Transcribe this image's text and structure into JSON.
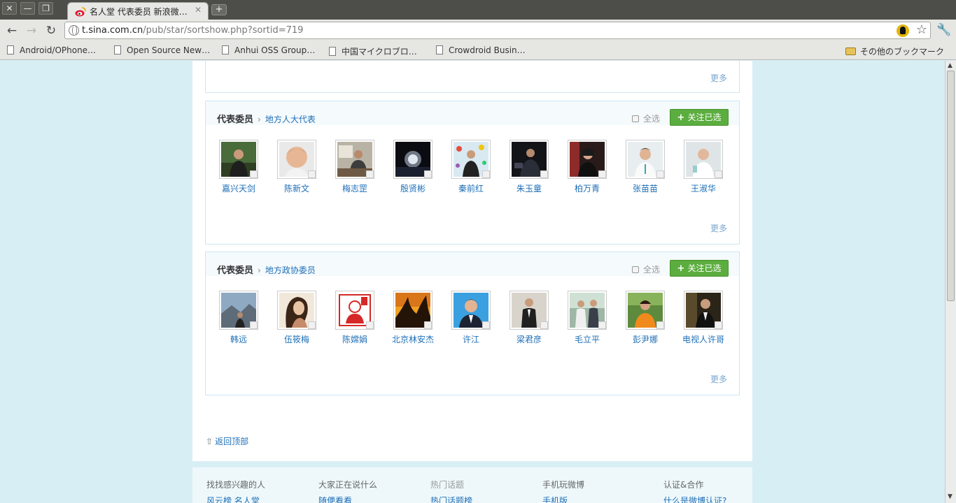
{
  "browser": {
    "tab_title": "名人堂 代表委员 新浪微…",
    "url_host": "t.sina.com.cn",
    "url_path": "/pub/star/sortshow.php?sortid=719",
    "bookmarks": [
      "Android/OPhone…",
      "Open Source New…",
      "Anhui OSS Group…",
      "中国マイクロブロ…",
      "Crowdroid Busin…"
    ],
    "other_bookmarks": "その他のブックマーク"
  },
  "top_panel": {
    "more": "更多"
  },
  "panels": [
    {
      "category": "代表委员",
      "subcategory": "地方人大代表",
      "select_all": "全选",
      "follow_selected": "关注已选",
      "more": "更多",
      "users": [
        "嘉兴天剑",
        "陈新文",
        "梅志罡",
        "殷贤彬",
        "秦前红",
        "朱玉童",
        "柏万青",
        "张苗苗",
        "王淑华"
      ]
    },
    {
      "category": "代表委员",
      "subcategory": "地方政协委员",
      "select_all": "全选",
      "follow_selected": "关注已选",
      "more": "更多",
      "users": [
        "韩远",
        "伍筱梅",
        "陈嫦娟",
        "北京林安杰",
        "许江",
        "梁君彦",
        "毛立平",
        "彭尹娜",
        "电视人许哥"
      ]
    }
  ],
  "back_to_top": "返回顶部",
  "footer": {
    "columns": [
      {
        "title": "找找感兴趣的人",
        "link": "风云榜 名人堂"
      },
      {
        "title": "大家正在说什么",
        "link": "随便看看"
      },
      {
        "title": "热门话题",
        "link": "热门话题榜"
      },
      {
        "title": "手机玩微博",
        "link": "手机版"
      },
      {
        "title": "认证&合作",
        "link": "什么是微博认证?"
      }
    ]
  },
  "colors": {
    "link": "#1e6fb6",
    "follow_button": "#5cad3f",
    "page_bg": "#d8eef5"
  }
}
